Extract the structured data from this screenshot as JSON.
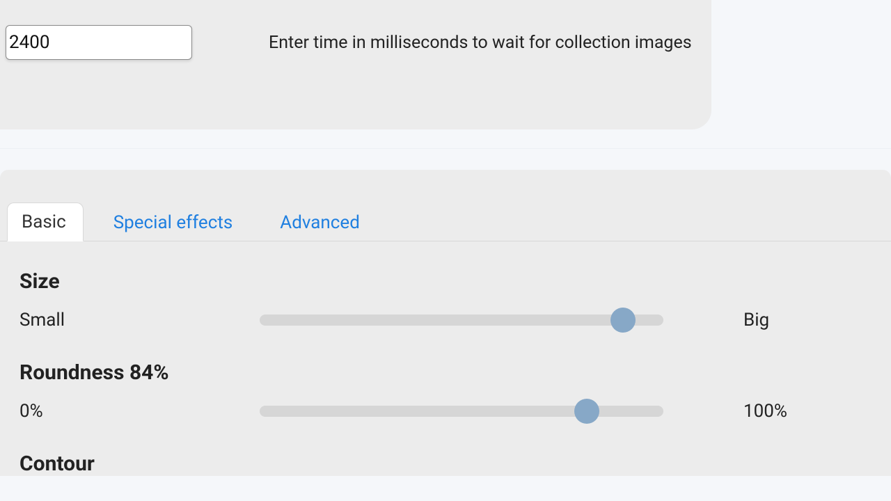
{
  "top": {
    "time_value": "2400",
    "helper": "Enter time in milliseconds to wait for collection images"
  },
  "tabs": {
    "basic": "Basic",
    "special_effects": "Special effects",
    "advanced": "Advanced"
  },
  "size": {
    "title": "Size",
    "left": "Small",
    "right": "Big",
    "percent": 90
  },
  "roundness": {
    "title": "Roundness 84%",
    "left": "0%",
    "right": "100%",
    "percent": 81
  },
  "contour": {
    "title": "Contour"
  }
}
